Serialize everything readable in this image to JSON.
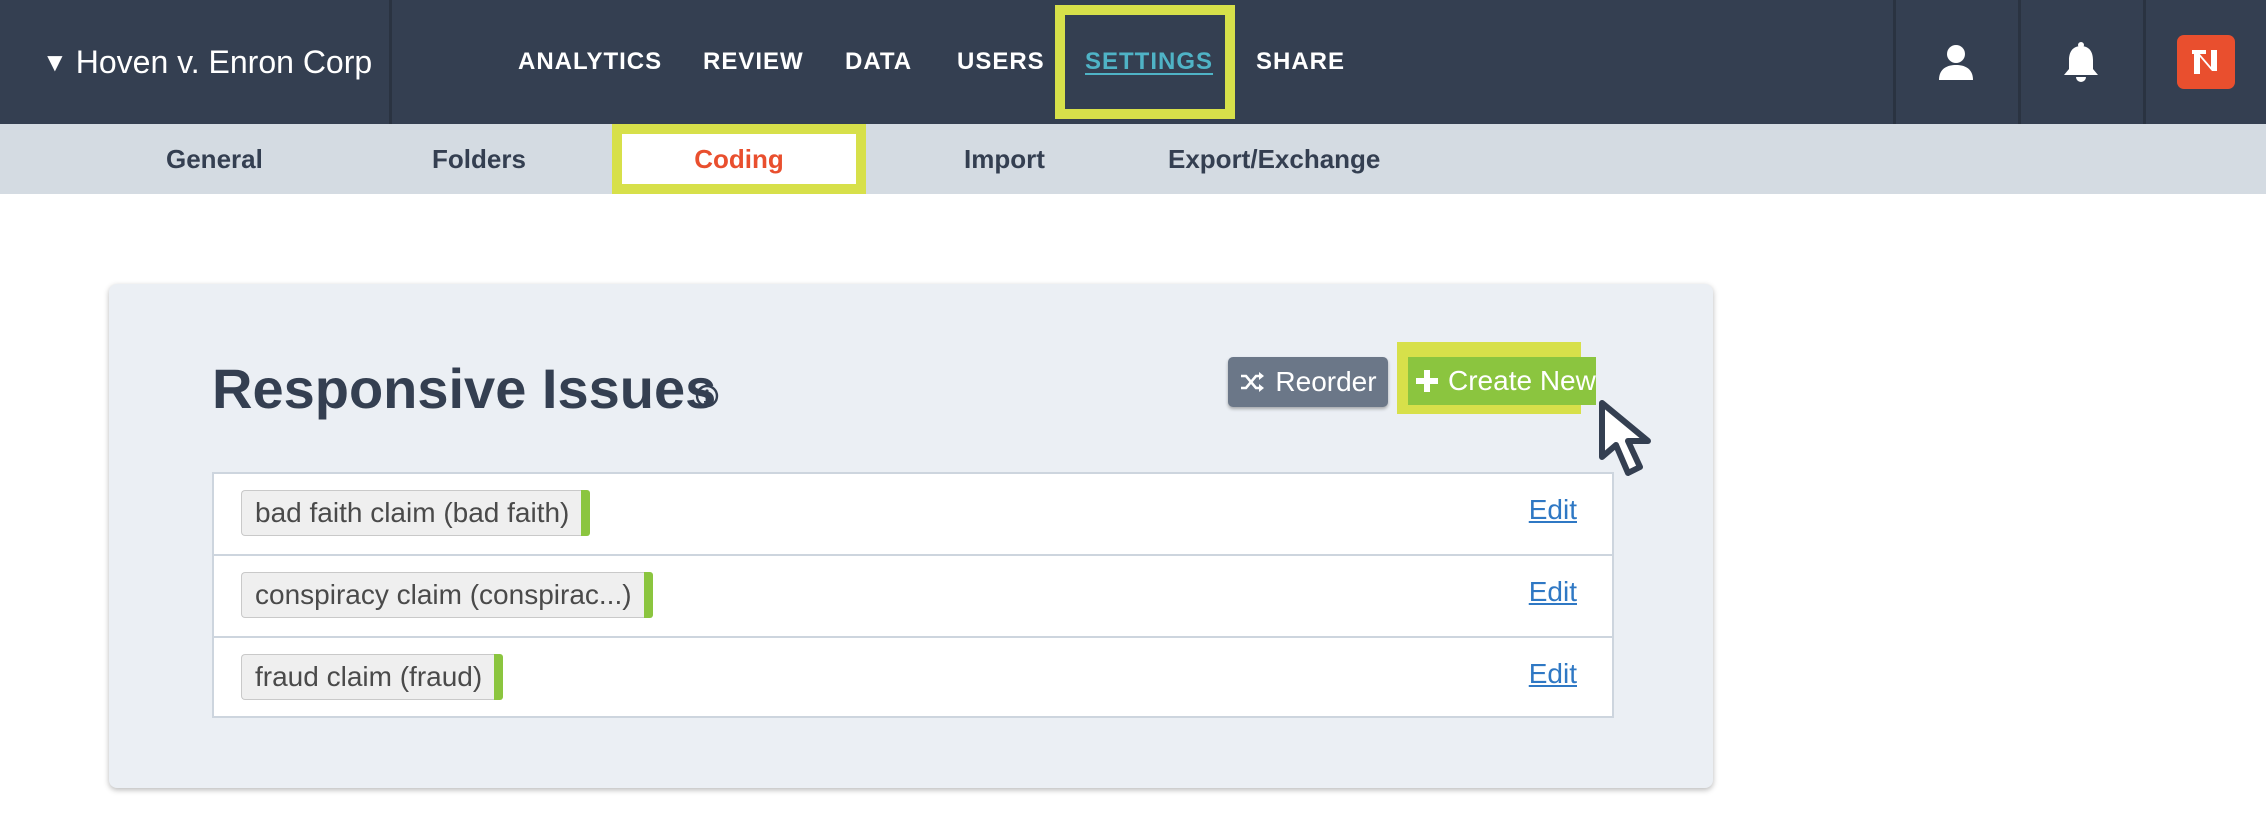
{
  "project": {
    "caret": "▼",
    "name": "Hoven v. Enron Corp"
  },
  "nav": {
    "items": [
      {
        "label": "ANALYTICS"
      },
      {
        "label": "REVIEW"
      },
      {
        "label": "DATA"
      },
      {
        "label": "USERS"
      },
      {
        "label": "SETTINGS",
        "active": true
      },
      {
        "label": "SHARE"
      }
    ]
  },
  "icons": {
    "user": "user-icon",
    "bell": "bell-icon",
    "logo": "nexlp-logo"
  },
  "subnav": {
    "items": [
      {
        "label": "General"
      },
      {
        "label": "Folders"
      },
      {
        "label": "Coding",
        "active": true
      },
      {
        "label": "Import"
      },
      {
        "label": "Export/Exchange"
      }
    ]
  },
  "panel": {
    "title": "Responsive Issues",
    "reorder_label": "Reorder",
    "create_label": "Create New",
    "issues": [
      {
        "tag": "bad faith claim (bad faith)",
        "action": "Edit"
      },
      {
        "tag": "conspiracy claim (conspirac...)",
        "action": "Edit"
      },
      {
        "tag": "fraud claim (fraud)",
        "action": "Edit"
      }
    ]
  },
  "colors": {
    "nav_bg": "#343f51",
    "subnav_bg": "#d4dbe2",
    "highlight": "#d7e04a",
    "accent_orange": "#e94f2e",
    "active_link": "#4fb3c6",
    "create_green": "#8bc53f",
    "reorder_gray": "#6b7788",
    "edit_link": "#2f78c4"
  }
}
